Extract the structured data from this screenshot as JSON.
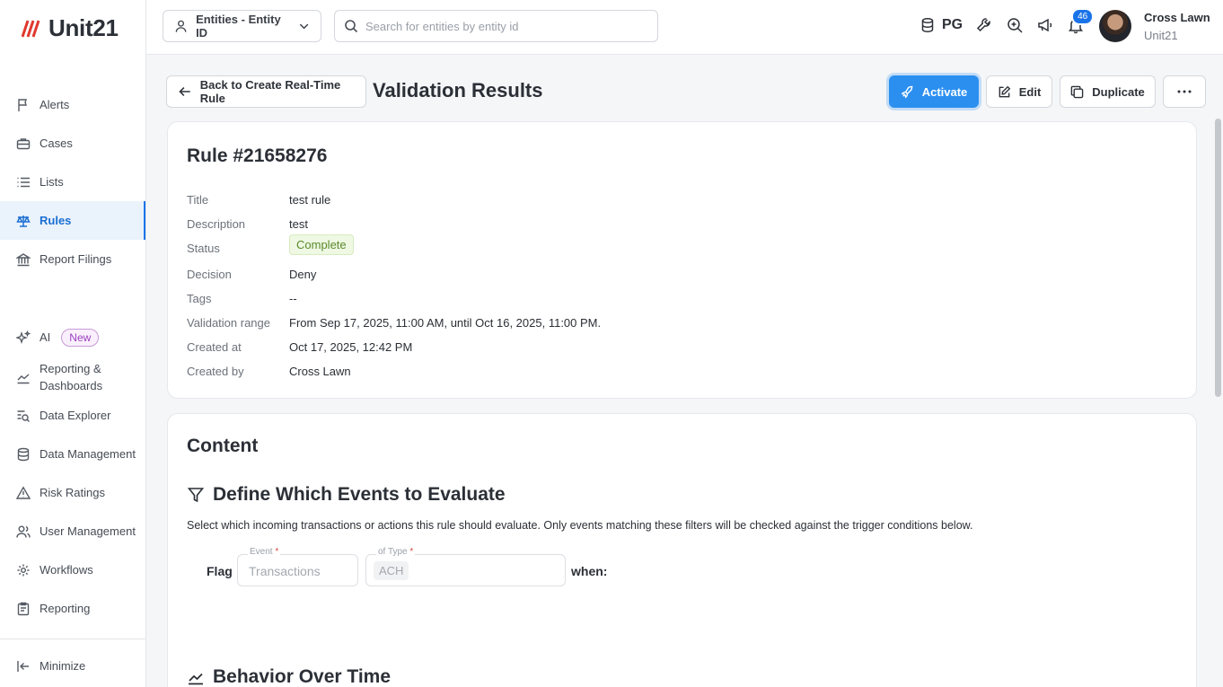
{
  "app": {
    "logo_text": "Unit21"
  },
  "sidebar": {
    "items": [
      {
        "label": "Alerts",
        "icon": "flag-icon"
      },
      {
        "label": "Cases",
        "icon": "briefcase-icon"
      },
      {
        "label": "Lists",
        "icon": "list-icon"
      },
      {
        "label": "Rules",
        "icon": "scale-icon",
        "active": true
      },
      {
        "label": "Report Filings",
        "icon": "bank-icon"
      },
      {
        "label": "AI",
        "icon": "sparkle-icon",
        "badge": "New"
      },
      {
        "label": "Reporting & Dashboards",
        "icon": "chart-line-icon"
      },
      {
        "label": "Data Explorer",
        "icon": "data-search-icon"
      },
      {
        "label": "Data Management",
        "icon": "database-icon"
      },
      {
        "label": "Risk Ratings",
        "icon": "warning-icon"
      },
      {
        "label": "User Management",
        "icon": "users-icon"
      },
      {
        "label": "Workflows",
        "icon": "workflow-icon"
      },
      {
        "label": "Reporting",
        "icon": "clipboard-icon"
      }
    ],
    "minimize_label": "Minimize"
  },
  "topbar": {
    "entity_select": "Entities - Entity ID",
    "search_placeholder": "Search for entities by entity id",
    "db_label": "PG",
    "notification_count": "46",
    "user": {
      "name": "Cross Lawn",
      "org": "Unit21"
    }
  },
  "header": {
    "back_label": "Back to Create Real-Time Rule",
    "title": "Validation Results",
    "actions": {
      "activate": "Activate",
      "edit": "Edit",
      "duplicate": "Duplicate"
    }
  },
  "rule": {
    "heading": "Rule #21658276",
    "fields": [
      {
        "key": "Title",
        "value": "test rule"
      },
      {
        "key": "Description",
        "value": "test"
      },
      {
        "key": "Status",
        "value": "Complete"
      },
      {
        "key": "Decision",
        "value": "Deny"
      },
      {
        "key": "Tags",
        "value": "--"
      },
      {
        "key": "Validation range",
        "value": "From Sep 17, 2025, 11:00 AM, until Oct 16, 2025, 11:00 PM."
      },
      {
        "key": "Created at",
        "value": "Oct 17, 2025, 12:42 PM"
      },
      {
        "key": "Created by",
        "value": "Cross Lawn"
      }
    ]
  },
  "content": {
    "title": "Content",
    "events_section": {
      "heading": "Define Which Events to Evaluate",
      "description": "Select which incoming transactions or actions this rule should evaluate. Only events matching these filters will be checked against the trigger conditions below.",
      "flag_label": "Flag",
      "event_label": "Event",
      "event_value": "Transactions",
      "type_label": "of Type",
      "type_value": "ACH",
      "when_label": "when:"
    },
    "behavior_section": {
      "heading": "Behavior Over Time"
    }
  },
  "colors": {
    "accent": "#2b8ff0",
    "active_nav": "#1a6fd1",
    "status_bg": "#eef8e3",
    "badge": "#9b3fc0"
  }
}
